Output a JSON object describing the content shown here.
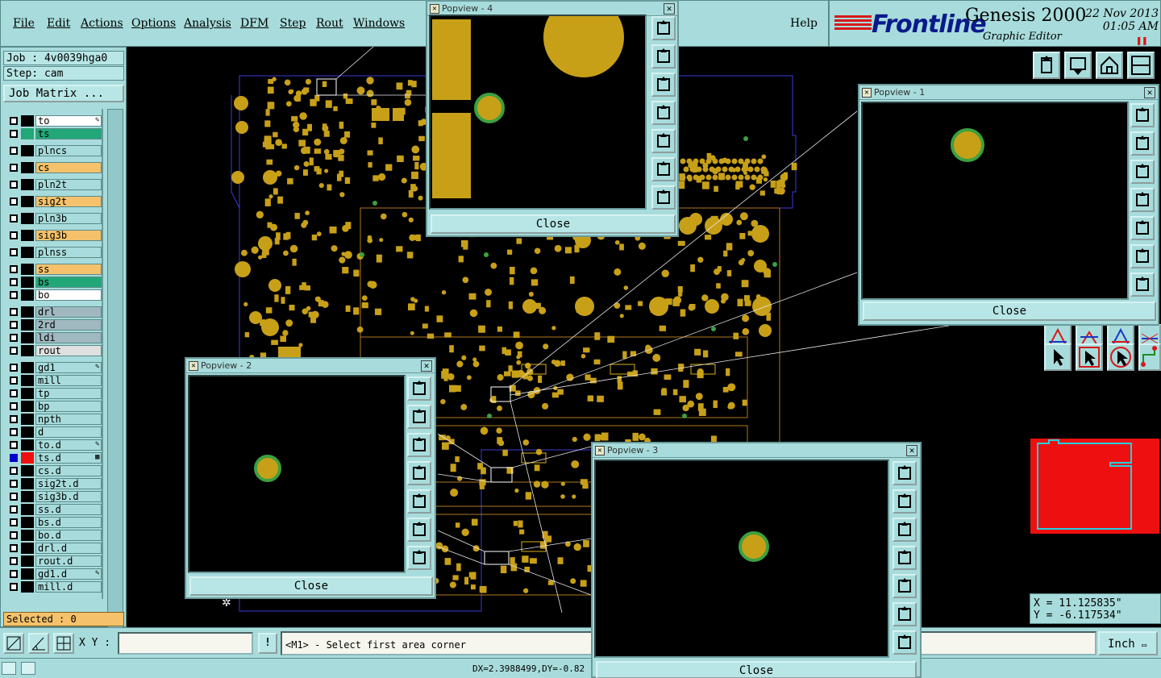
{
  "menubar": {
    "items": [
      "File",
      "Edit",
      "Actions",
      "Options",
      "Analysis",
      "DFM",
      "Step",
      "Rout",
      "Windows"
    ],
    "help": "Help"
  },
  "brand": {
    "logo": "Frontline",
    "product": "Genesis 2000",
    "subtitle": "Graphic Editor",
    "date": "22 Nov 2013",
    "time": "01:05 AM"
  },
  "job": {
    "job_label": "Job : 4v0039hga0",
    "step_label": "Step: cam",
    "matrix_button": "Job Matrix ..."
  },
  "layers": [
    {
      "name": "to",
      "color": "#ffffff",
      "swatch": "#000000",
      "flag": "pen"
    },
    {
      "name": "ts",
      "color": "#22a878",
      "swatch": "#22a878"
    },
    {
      "name": "plncs",
      "color": "#a8dcdc",
      "swatch": "#000000"
    },
    {
      "name": "cs",
      "color": "#f5c26b",
      "swatch": "#000000"
    },
    {
      "name": "pln2t",
      "color": "#a8dcdc",
      "swatch": "#000000"
    },
    {
      "name": "sig2t",
      "color": "#f5c26b",
      "swatch": "#000000"
    },
    {
      "name": "pln3b",
      "color": "#a8dcdc",
      "swatch": "#000000"
    },
    {
      "name": "sig3b",
      "color": "#f5c26b",
      "swatch": "#000000"
    },
    {
      "name": "plnss",
      "color": "#a8dcdc",
      "swatch": "#000000"
    },
    {
      "name": "ss",
      "color": "#f5c26b",
      "swatch": "#000000"
    },
    {
      "name": "bs",
      "color": "#22a878",
      "swatch": "#000000"
    },
    {
      "name": "bo",
      "color": "#ffffff",
      "swatch": "#000000"
    },
    {
      "name": "drl",
      "color": "#a0b8c0",
      "swatch": "#000000"
    },
    {
      "name": "2rd",
      "color": "#a0b8c0",
      "swatch": "#000000"
    },
    {
      "name": "ldi",
      "color": "#a0b8c0",
      "swatch": "#000000"
    },
    {
      "name": "rout",
      "color": "#e0e0e0",
      "swatch": "#000000"
    },
    {
      "name": "gd1",
      "color": "#a8dcdc",
      "swatch": "#000000",
      "flag": "pen"
    },
    {
      "name": "mill",
      "color": "#a8dcdc",
      "swatch": "#000000"
    },
    {
      "name": "tp",
      "color": "#a8dcdc",
      "swatch": "#000000"
    },
    {
      "name": "bp",
      "color": "#a8dcdc",
      "swatch": "#000000"
    },
    {
      "name": "npth",
      "color": "#a8dcdc",
      "swatch": "#000000"
    },
    {
      "name": "d",
      "color": "#a8dcdc",
      "swatch": "#000000"
    },
    {
      "name": "to.d",
      "color": "#a8dcdc",
      "swatch": "#000000",
      "flag": "pen"
    },
    {
      "name": "ts.d",
      "color": "#a8dcdc",
      "swatch": "#ee1010",
      "selected": true,
      "flag": "grid"
    },
    {
      "name": "cs.d",
      "color": "#a8dcdc",
      "swatch": "#000000"
    },
    {
      "name": "sig2t.d",
      "color": "#a8dcdc",
      "swatch": "#000000"
    },
    {
      "name": "sig3b.d",
      "color": "#a8dcdc",
      "swatch": "#000000"
    },
    {
      "name": "ss.d",
      "color": "#a8dcdc",
      "swatch": "#000000"
    },
    {
      "name": "bs.d",
      "color": "#a8dcdc",
      "swatch": "#000000"
    },
    {
      "name": "bo.d",
      "color": "#a8dcdc",
      "swatch": "#000000"
    },
    {
      "name": "drl.d",
      "color": "#a8dcdc",
      "swatch": "#000000"
    },
    {
      "name": "rout.d",
      "color": "#a8dcdc",
      "swatch": "#000000"
    },
    {
      "name": "gd1.d",
      "color": "#a8dcdc",
      "swatch": "#000000",
      "flag": "pen"
    },
    {
      "name": "mill.d",
      "color": "#a8dcdc",
      "swatch": "#000000"
    }
  ],
  "selected_label": "Selected : 0",
  "cmd": {
    "xy_label": "X Y :",
    "xy_value": "",
    "bang": "!",
    "prompt": "<M1> - Select first area corner",
    "unit": "Inch"
  },
  "status": {
    "text": "DX=2.3988499,DY=-0.82"
  },
  "coords": {
    "x": "X = 11.125835\"",
    "y": "Y = -6.117534\""
  },
  "popviews": [
    {
      "title": "Popview - 4",
      "close": "Close"
    },
    {
      "title": "Popview - 1",
      "close": "Close"
    },
    {
      "title": "Popview - 2",
      "close": "Close"
    },
    {
      "title": "Popview - 3",
      "close": "Close"
    }
  ],
  "colors": {
    "copper": "#c8a018",
    "mask": "#3ca040",
    "outline": "#3c3cd8",
    "panel": "#a8dcdc",
    "minimap": "#ee1010"
  }
}
